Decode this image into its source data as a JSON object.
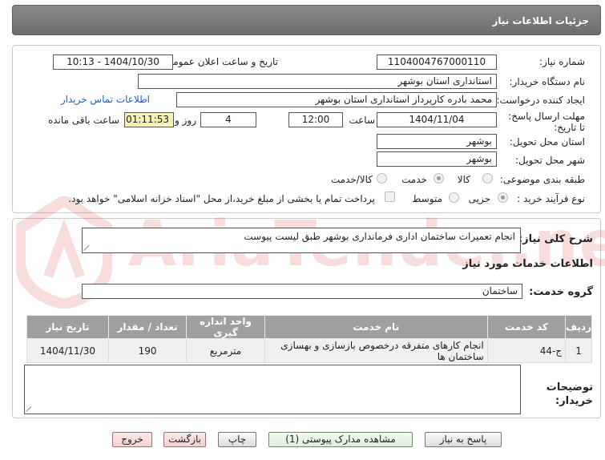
{
  "header": {
    "title": "جزئیات اطلاعات نیاز"
  },
  "form": {
    "need_number_label": "شماره نیاز:",
    "need_number": "1104004767000110",
    "announce_label": "تاریخ و ساعت اعلان عمومی:",
    "announce_value": "1404/10/30 - 10:13",
    "buyer_org_label": "نام دستگاه خریدار:",
    "buyer_org": "استانداری استان بوشهر",
    "creator_label": "ایجاد کننده درخواست:",
    "creator": "محمد بادره کارپرداز استانداری استان بوشهر",
    "contact_link": "اطلاعات تماس خریدار",
    "deadline_label": "مهلت ارسال پاسخ: تا تاریخ:",
    "deadline_date": "1404/11/04",
    "time_label": "ساعت",
    "deadline_time": "12:00",
    "days_value": "4",
    "days_label": "روز و",
    "remaining_time": "01:11:53",
    "remaining_label": "ساعت باقی مانده",
    "province_label": "استان محل تحویل:",
    "province": "بوشهر",
    "city_label": "شهر محل تحویل:",
    "city": "بوشهر",
    "category_label": "طبقه بندی موضوعی:",
    "category_options": [
      "کالا",
      "خدمت",
      "کالا/خدمت"
    ],
    "process_label": "نوع فرآیند خرید :",
    "process_options": [
      "جزیی",
      "متوسط"
    ],
    "payment_note": "پرداخت تمام یا بخشی از مبلغ خرید،از محل \"اسناد خزانه اسلامی\" خواهد بود."
  },
  "details": {
    "summary_label": "شرح کلی نیاز:",
    "summary": "انجام تعمیرات ساختمان اداری فرمانداری بوشهر طبق لیست پیوست",
    "services_heading": "اطلاعات خدمات مورد نیاز",
    "service_group_label": "گروه خدمت:",
    "service_group": "ساختمان",
    "table": {
      "headers": [
        "ردیف",
        "کد خدمت",
        "نام خدمت",
        "واحد اندازه گیری",
        "تعداد / مقدار",
        "تاریخ نیاز"
      ],
      "rows": [
        [
          "1",
          "ج-44",
          "انجام کارهای متفرقه درخصوص بازسازی و بهسازی ساختمان ها",
          "مترمربع",
          "190",
          "1404/11/30"
        ]
      ]
    },
    "buyer_notes_label": "توضیحات خریدار:"
  },
  "buttons": {
    "reply": "پاسخ به نیاز",
    "attachments": "مشاهده مدارک پیوستی (1)",
    "print": "چاپ",
    "back": "بازگشت",
    "exit": "خروج"
  },
  "watermark": "AriaTender.neT",
  "colors": {
    "header": "#777777",
    "yellow_field": "#f7f1b5",
    "link": "#1e5ec8"
  }
}
